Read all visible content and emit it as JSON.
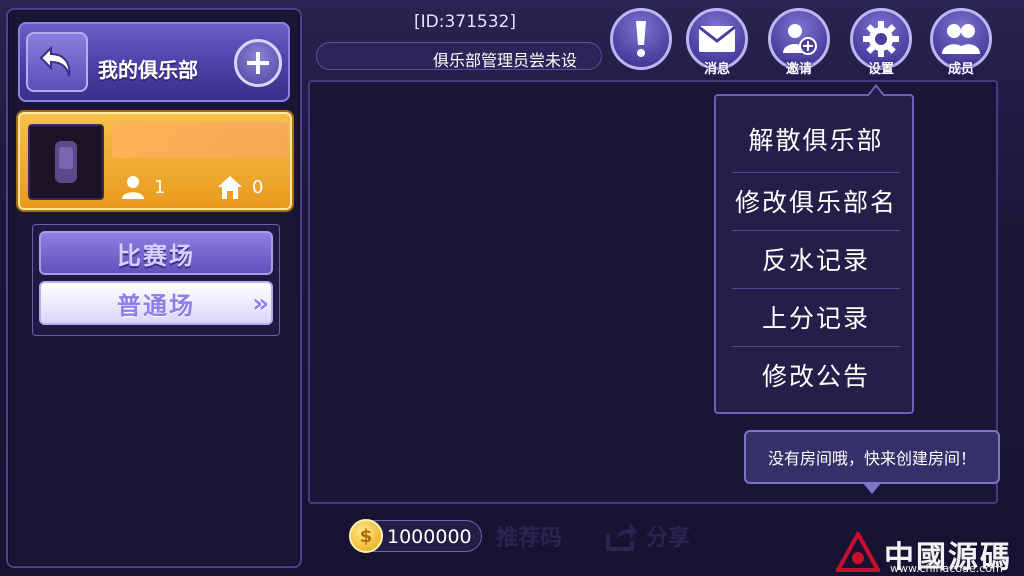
{
  "header": {
    "club_title": "我的俱乐部",
    "club_id": "[ID:371532]",
    "notice": "俱乐部管理员尝未设"
  },
  "club_card": {
    "members": "1",
    "rooms": "0"
  },
  "modes": {
    "match": "比赛场",
    "normal": "普通场",
    "normal_chevron": "»"
  },
  "top_buttons": {
    "alert_label": "",
    "message_label": "消息",
    "invite_label": "邀请",
    "settings_label": "设置",
    "members_label": "成员"
  },
  "settings_menu": {
    "items": [
      "解散俱乐部",
      "修改俱乐部名",
      "反水记录",
      "上分记录",
      "修改公告"
    ]
  },
  "toast": {
    "text": "没有房间哦，快来创建房间！"
  },
  "bottom": {
    "coins": "1000000",
    "coin_symbol": "$",
    "referral_label": "推荐码",
    "share_label": "分享"
  },
  "watermark": {
    "title": "中國源碼",
    "url": "www.chinacode.com"
  },
  "colors": {
    "panel_bg": "#1a1436",
    "accent_purple": "#6b5fc8",
    "card_gold": "#f0ac32"
  }
}
